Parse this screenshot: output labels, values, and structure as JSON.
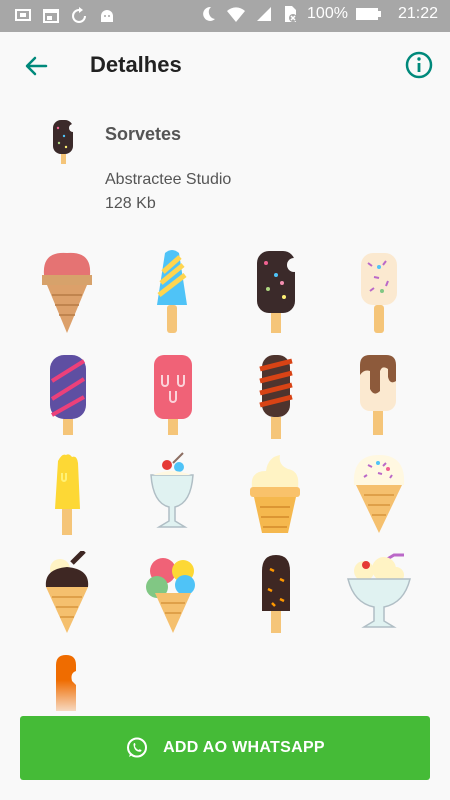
{
  "status_bar": {
    "battery_percent": "100%",
    "time": "21:22"
  },
  "app_bar": {
    "title": "Detalhes"
  },
  "pack": {
    "name": "Sorvetes",
    "publisher": "Abstractee Studio",
    "size": "128 Kb"
  },
  "stickers": [
    {
      "name": "sticker-strawberry-cone-icon"
    },
    {
      "name": "sticker-striped-popsicle-icon"
    },
    {
      "name": "sticker-chocolate-sprinkle-popsicle-icon"
    },
    {
      "name": "sticker-vanilla-sprinkle-popsicle-icon"
    },
    {
      "name": "sticker-purple-striped-popsicle-icon"
    },
    {
      "name": "sticker-pink-popsicle-icon"
    },
    {
      "name": "sticker-chocolate-twist-popsicle-icon"
    },
    {
      "name": "sticker-chocolate-dip-popsicle-icon"
    },
    {
      "name": "sticker-yellow-popsicle-icon"
    },
    {
      "name": "sticker-sundae-glass-icon"
    },
    {
      "name": "sticker-soft-serve-cup-icon"
    },
    {
      "name": "sticker-vanilla-sprinkle-cone-icon"
    },
    {
      "name": "sticker-chocolate-cone-icon"
    },
    {
      "name": "sticker-three-scoop-cone-icon"
    },
    {
      "name": "sticker-chocolate-nut-popsicle-icon"
    },
    {
      "name": "sticker-sundae-bowl-icon"
    },
    {
      "name": "sticker-orange-popsicle-icon"
    }
  ],
  "button": {
    "label": "ADD AO WHATSAPP"
  },
  "colors": {
    "accent": "#00897b",
    "button": "#45bb37",
    "status_bar": "#a7a7a7"
  }
}
